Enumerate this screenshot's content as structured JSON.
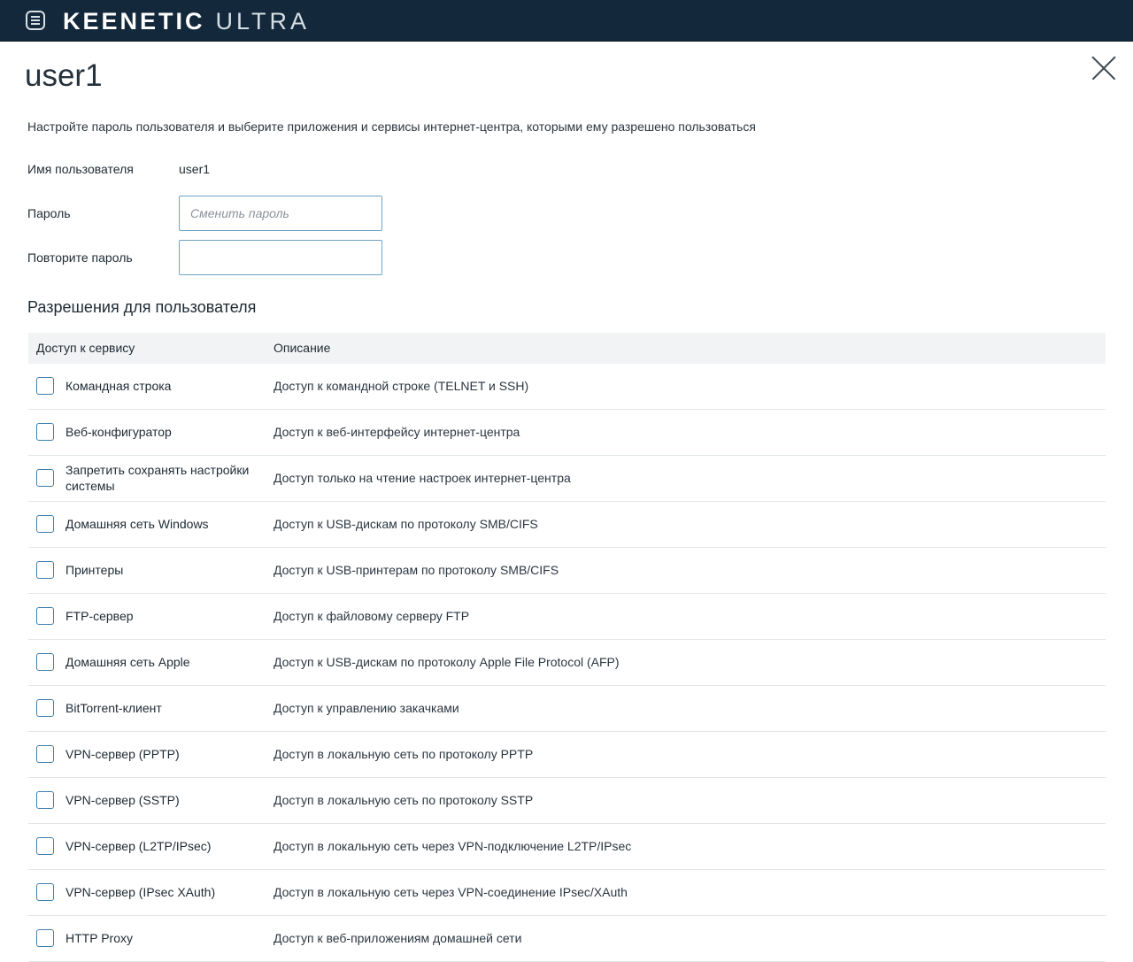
{
  "header": {
    "brand": "KEENETIC",
    "model": "ULTRA"
  },
  "page": {
    "title": "user1",
    "subtitle": "Настройте пароль пользователя и выберите приложения и сервисы интернет-центра, которыми ему разрешено пользоваться"
  },
  "form": {
    "username_label": "Имя пользователя",
    "username_value": "user1",
    "password_label": "Пароль",
    "password_placeholder": "Сменить пароль",
    "password_value": "",
    "repeat_label": "Повторите пароль",
    "repeat_value": ""
  },
  "permissions": {
    "title": "Разрешения для пользователя",
    "columns": [
      "Доступ к сервису",
      "Описание"
    ],
    "rows": [
      {
        "service": "Командная строка",
        "description": "Доступ к командной строке (TELNET и SSH)",
        "checked": false
      },
      {
        "service": "Веб-конфигуратор",
        "description": "Доступ к веб-интерфейсу интернет-центра",
        "checked": false
      },
      {
        "service": "Запретить сохранять настройки системы",
        "description": "Доступ только на чтение настроек интернет-центра",
        "checked": false
      },
      {
        "service": "Домашняя сеть Windows",
        "description": "Доступ к USB-дискам по протоколу SMB/CIFS",
        "checked": false
      },
      {
        "service": "Принтеры",
        "description": "Доступ к USB-принтерам по протоколу SMB/CIFS",
        "checked": false
      },
      {
        "service": "FTP-сервер",
        "description": "Доступ к файловому серверу FTP",
        "checked": false
      },
      {
        "service": "Домашняя сеть Apple",
        "description": "Доступ к USB-дискам по протоколу Apple File Protocol (AFP)",
        "checked": false
      },
      {
        "service": "BitTorrent-клиент",
        "description": "Доступ к управлению закачками",
        "checked": false
      },
      {
        "service": "VPN-сервер (PPTP)",
        "description": "Доступ в локальную сеть по протоколу PPTP",
        "checked": false
      },
      {
        "service": "VPN-сервер (SSTP)",
        "description": "Доступ в локальную сеть по протоколу SSTP",
        "checked": false
      },
      {
        "service": "VPN-сервер (L2TP/IPsec)",
        "description": "Доступ в локальную сеть через VPN-подключение L2TP/IPsec",
        "checked": false
      },
      {
        "service": "VPN-сервер (IPsec XAuth)",
        "description": "Доступ в локальную сеть через VPN-соединение IPsec/XAuth",
        "checked": false
      },
      {
        "service": "HTTP Proxy",
        "description": "Доступ к веб-приложениям домашней сети",
        "checked": false
      }
    ]
  },
  "icons": {
    "menu": "menu-icon",
    "close": "close-icon"
  },
  "colors": {
    "header_bg": "#13283a",
    "accent": "#3e7fae",
    "table_header_bg": "#f2f3f4"
  }
}
